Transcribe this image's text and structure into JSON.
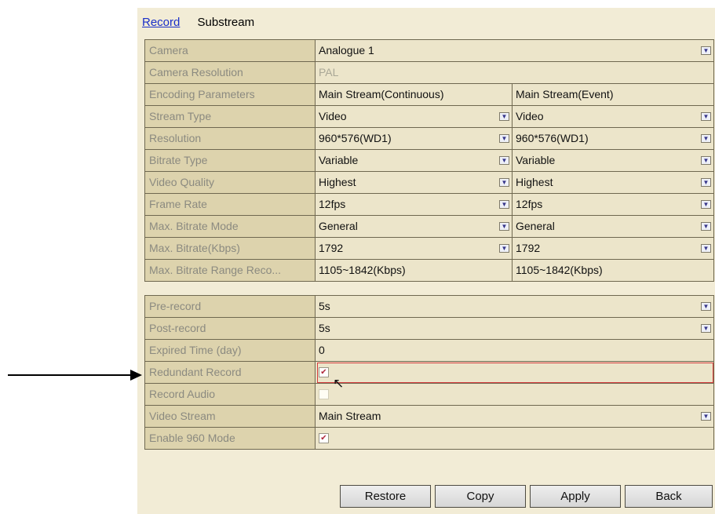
{
  "tabs": [
    "Record",
    "Substream"
  ],
  "rows1": [
    {
      "label": "Camera",
      "value": "Analogue 1",
      "dropdown": true
    },
    {
      "label": "Camera Resolution",
      "value": "PAL",
      "dim": true
    },
    {
      "label": "Encoding Parameters",
      "left": "Main Stream(Continuous)",
      "right": "Main Stream(Event)"
    },
    {
      "label": "Stream Type",
      "left": "Video",
      "right": "Video",
      "dropdown": true
    },
    {
      "label": "Resolution",
      "left": "960*576(WD1)",
      "right": "960*576(WD1)",
      "dropdown": true
    },
    {
      "label": "Bitrate Type",
      "left": "Variable",
      "right": "Variable",
      "dropdown": true
    },
    {
      "label": "Video Quality",
      "left": "Highest",
      "right": "Highest",
      "dropdown": true
    },
    {
      "label": "Frame Rate",
      "left": "12fps",
      "right": "12fps",
      "dropdown": true
    },
    {
      "label": "Max. Bitrate Mode",
      "left": "General",
      "right": "General",
      "dropdown": true
    },
    {
      "label": "Max. Bitrate(Kbps)",
      "left": "1792",
      "right": "1792",
      "dropdown": true
    },
    {
      "label": "Max. Bitrate Range Reco...",
      "left": "1105~1842(Kbps)",
      "right": "1105~1842(Kbps)"
    }
  ],
  "rows2": [
    {
      "label": "Pre-record",
      "value": "5s",
      "dropdown": true
    },
    {
      "label": "Post-record",
      "value": "5s",
      "dropdown": true
    },
    {
      "label": "Expired Time (day)",
      "value": "0"
    },
    {
      "label": "Redundant Record",
      "checkbox": true,
      "checked": true
    },
    {
      "label": "Record Audio",
      "checkbox": true,
      "checked": false
    },
    {
      "label": "Video Stream",
      "value": "Main Stream",
      "dropdown": true
    },
    {
      "label": "Enable 960 Mode",
      "checkbox": true,
      "checked": true
    }
  ],
  "buttons": [
    "Restore",
    "Copy",
    "Apply",
    "Back"
  ],
  "icons": {
    "dropdown": "chevron-down-icon",
    "check": "checkmark-icon",
    "cursor": "mouse-cursor-icon"
  }
}
